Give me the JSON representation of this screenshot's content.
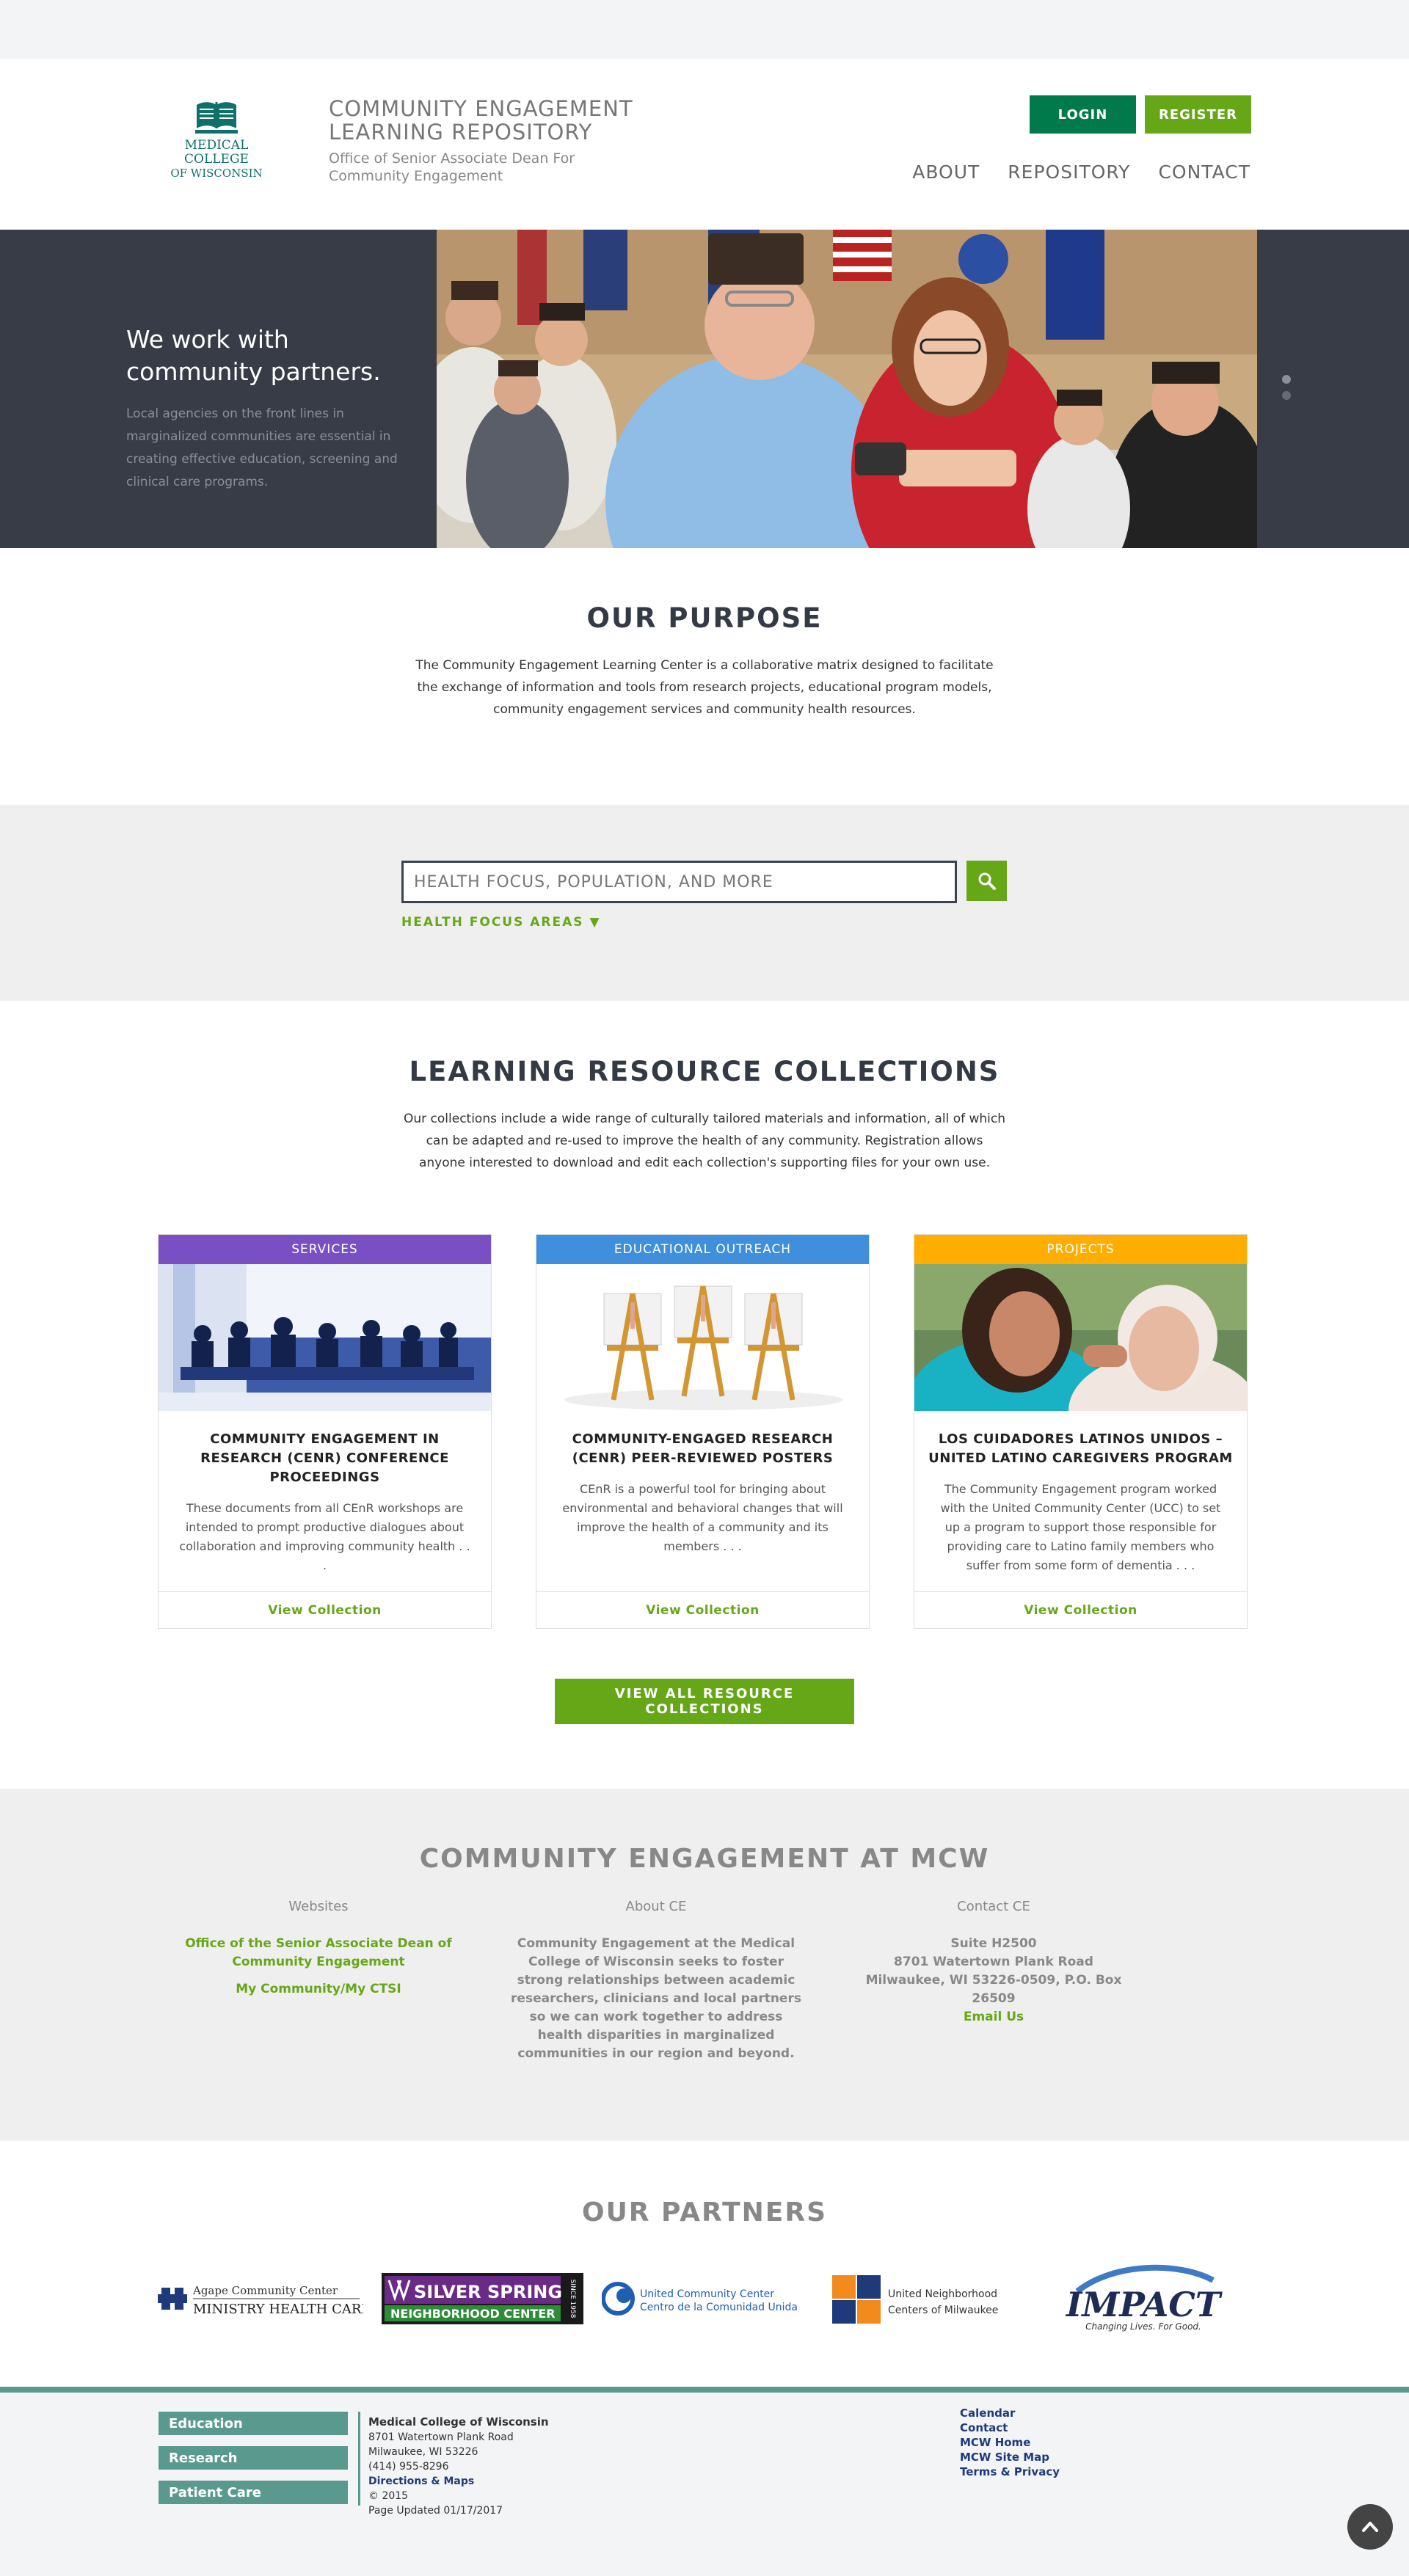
{
  "header": {
    "logo": {
      "line1": "MEDICAL",
      "line2": "COLLEGE",
      "line3": "OF WISCONSIN"
    },
    "title_line1": "COMMUNITY ENGAGEMENT",
    "title_line2": "LEARNING REPOSITORY",
    "subtitle_line1": "Office of Senior Associate Dean For",
    "subtitle_line2": "Community Engagement",
    "login": "LOGIN",
    "register": "REGISTER",
    "nav": [
      "ABOUT",
      "REPOSITORY",
      "CONTACT"
    ]
  },
  "hero": {
    "title_line1": "We work with",
    "title_line2": "community partners.",
    "description": "Local agencies on the front lines in marginalized communities are essential in creating effective education, screening and clinical care programs."
  },
  "purpose": {
    "heading": "OUR PURPOSE",
    "text": "The Community Engagement Learning Center is a collaborative matrix designed to facilitate the exchange of information and tools from research projects, educational program models, community engagement services and community health resources."
  },
  "search": {
    "placeholder": "HEALTH FOCUS, POPULATION, AND MORE",
    "focus_toggle": "HEALTH FOCUS AREAS ▼"
  },
  "collections": {
    "heading": "LEARNING RESOURCE COLLECTIONS",
    "intro": "Our collections include a wide range of culturally tailored materials and information, all of which can be adapted and re-used to improve the health of any community. Registration allows anyone interested to download and edit each collection's supporting files for your own use.",
    "cards": [
      {
        "tag": "SERVICES",
        "tag_color": "#7b4fc4",
        "title": "COMMUNITY ENGAGEMENT IN RESEARCH (CENR) CONFERENCE PROCEEDINGS",
        "text": "These documents from all CEnR workshops are intended to prompt productive dialogues about collaboration and improving community health . . .",
        "link": "View Collection"
      },
      {
        "tag": "EDUCATIONAL OUTREACH",
        "tag_color": "#3f8fdc",
        "title": "COMMUNITY-ENGAGED RESEARCH (CENR) PEER-REVIEWED POSTERS",
        "text": "CEnR is a powerful tool for bringing about environmental and behavioral changes that will improve the health of a community and its members . . .",
        "link": "View Collection"
      },
      {
        "tag": "PROJECTS",
        "tag_color": "#ffae00",
        "title": "LOS CUIDADORES LATINOS UNIDOS – UNITED LATINO CAREGIVERS PROGRAM",
        "text": "The Community Engagement program worked with the United Community Center (UCC) to set up a program to support those responsible for providing care to Latino family members who suffer from some form of dementia . . .",
        "link": "View Collection"
      }
    ],
    "view_all": "VIEW ALL RESOURCE COLLECTIONS"
  },
  "ce": {
    "heading": "COMMUNITY ENGAGEMENT AT MCW",
    "websites_heading": "Websites",
    "websites": [
      "Office of the Senior Associate Dean of Community Engagement",
      "My Community/My CTSI"
    ],
    "about_heading": "About CE",
    "about_text": "Community Engagement at the Medical College of Wisconsin seeks to foster strong relationships between academic researchers, clinicians and local partners so we can work together to address health disparities in marginalized communities in our region and beyond.",
    "contact_heading": "Contact CE",
    "contact_line1": "Suite H2500",
    "contact_line2": "8701 Watertown Plank Road",
    "contact_line3": "Milwaukee, WI 53226-0509, P.O. Box 26509",
    "contact_email": "Email Us"
  },
  "partners": {
    "heading": "OUR PARTNERS",
    "agape_1": "Agape Community Center",
    "agape_2": "MINISTRY HEALTH CARE",
    "silver_1": "SILVER SPRING",
    "silver_2": "NEIGHBORHOOD CENTER",
    "silver_since": "SINCE 1958",
    "ucc_1": "United Community Center",
    "ucc_2": "Centro de la Comunidad Unida",
    "un_1": "United Neighborhood",
    "un_2": "Centers of Milwaukee",
    "impact_1": "IMPACT",
    "impact_2": "Changing Lives. For Good."
  },
  "footer": {
    "nav": [
      "Education",
      "Research",
      "Patient Care"
    ],
    "org": "Medical College of Wisconsin",
    "addr1": "8701 Watertown Plank Road",
    "addr2": "Milwaukee, WI 53226",
    "phone": "(414) 955-8296",
    "directions": "Directions & Maps",
    "copyright": "© 2015",
    "updated": "Page Updated 01/17/2017",
    "links": [
      "Calendar",
      "Contact",
      "MCW Home",
      "MCW Site Map",
      "Terms & Privacy"
    ]
  },
  "colors": {
    "green": "#66a718",
    "dark_green": "#007a4a",
    "teal": "#5a9a8e",
    "slate": "#373c47"
  }
}
